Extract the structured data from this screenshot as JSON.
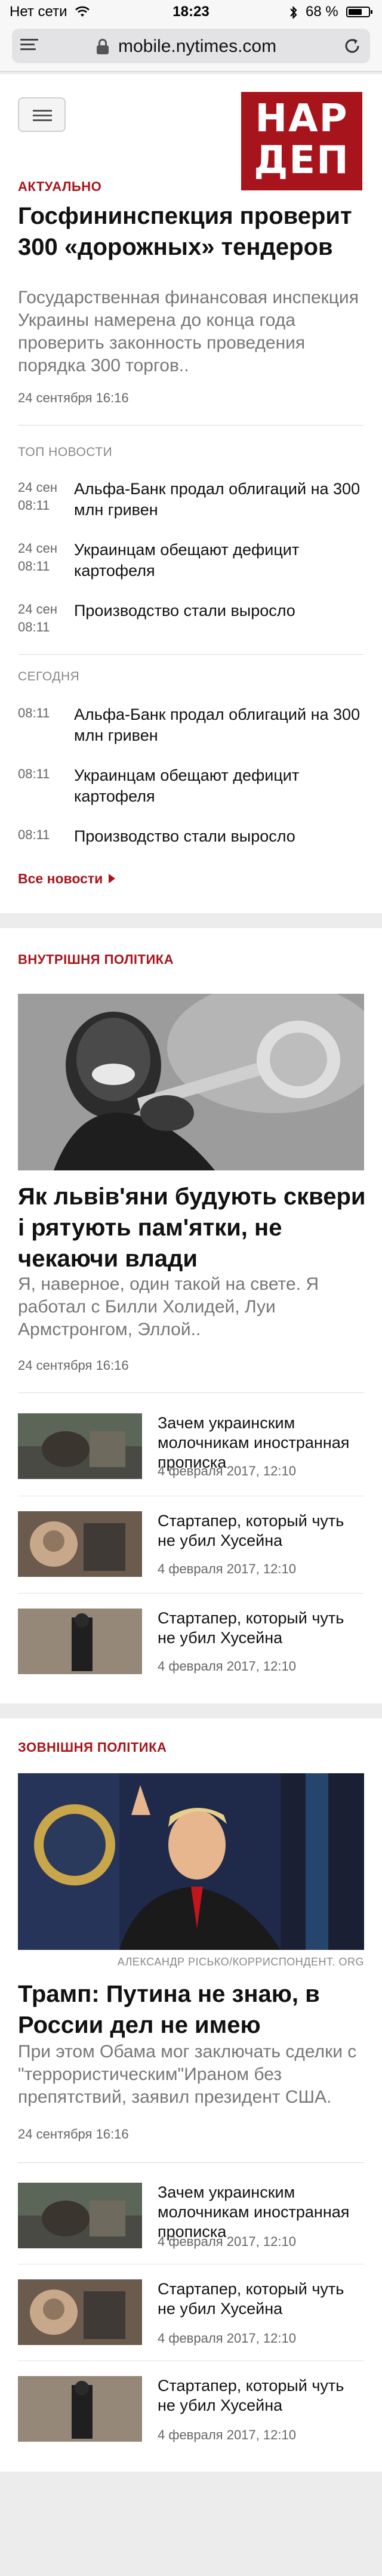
{
  "status_bar": {
    "carrier": "Нет сети",
    "time": "18:23",
    "battery_text": "68 %",
    "battery_level": 0.68
  },
  "browser": {
    "url": "mobile.nytimes.com"
  },
  "logo": {
    "line1": "НАР",
    "line2": "ДЕП"
  },
  "top_story": {
    "label": "АКТУАЛЬНО",
    "headline": "Госфининспекция проверит 300 «дорожных» тендеров",
    "lede": "Государственная финансовая инспекция Украины намерена до конца года проверить законность проведения порядка 300 торгов..",
    "date": "24 сентября 16:16"
  },
  "top_news": {
    "label": "ТОП НОВОСТИ",
    "items": [
      {
        "day": "24 сен",
        "time": "08:11",
        "title": "Альфа-Банк продал облигаций на 300 млн гривен"
      },
      {
        "day": "24 сен",
        "time": "08:11",
        "title": "Украинцам обещают дефицит картофеля"
      },
      {
        "day": "24 сен",
        "time": "08:11",
        "title": "Производство стали выросло"
      }
    ]
  },
  "today_news": {
    "label": "СЕГОДНЯ",
    "items": [
      {
        "time": "08:11",
        "title": "Альфа-Банк продал облигаций на 300 млн гривен"
      },
      {
        "time": "08:11",
        "title": "Украинцам обещают дефицит картофеля"
      },
      {
        "time": "08:11",
        "title": "Производство стали выросло"
      }
    ]
  },
  "all_news_label": "Все новости",
  "domestic": {
    "label": "ВНУТРІШНЯ ПОЛІТИКА",
    "headline": "Як львів'яни будують сквери і рятують пам'ятки, не чекаючи влади",
    "lede": "Я, наверное, один такой на свете. Я работал с Билли Холидей, Луи Армстронгом, Эллой..",
    "date": "24 сентября 16:16",
    "items": [
      {
        "title": "Зачем украинским молочникам иностранная прописка",
        "date": "4 февраля 2017, 12:10"
      },
      {
        "title": "Стартапер, который чуть не убил Хусейна",
        "date": "4 февраля 2017, 12:10"
      },
      {
        "title": "Стартапер, который чуть не убил Хусейна",
        "date": "4 февраля 2017, 12:10"
      }
    ]
  },
  "foreign": {
    "label": "ЗОВНІШНЯ ПОЛІТИКА",
    "credit": "АЛЕКСАНДР РІСЬКО/КОРРИСПОНДЕНТ. ORG",
    "headline": "Трамп: Путина не знаю, в России дел не имею",
    "lede": "При этом Обама мог заключать сделки с \"террористическим\"Ираном без препятствий, заявил президент США.",
    "date": "24 сентября 16:16",
    "items": [
      {
        "title": "Зачем украинским молочникам иностранная прописка",
        "date": "4 февраля 2017, 12:10"
      },
      {
        "title": "Стартапер, который чуть не убил Хусейна",
        "date": "4 февраля 2017, 12:10"
      },
      {
        "title": "Стартапер, который чуть не убил Хусейна",
        "date": "4 февраля 2017, 12:10"
      }
    ]
  }
}
